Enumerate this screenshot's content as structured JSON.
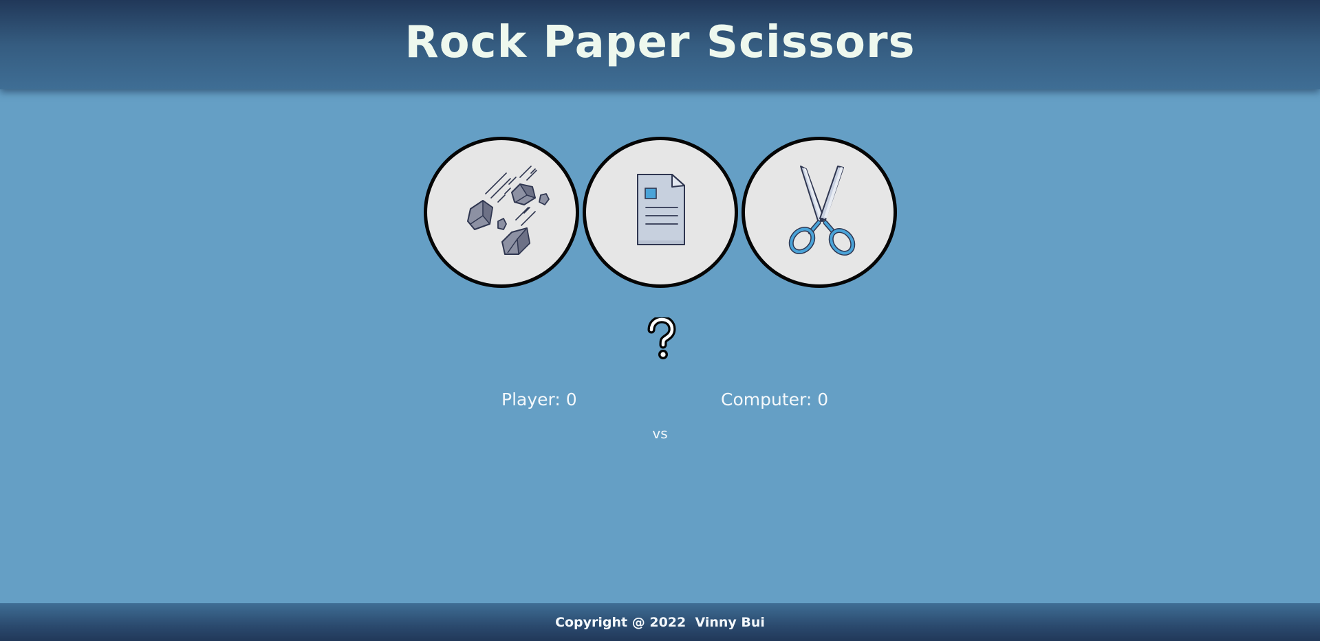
{
  "header": {
    "title": "Rock Paper Scissors"
  },
  "choices": [
    {
      "name": "rock",
      "icon": "rock-icon"
    },
    {
      "name": "paper",
      "icon": "paper-icon"
    },
    {
      "name": "scissors",
      "icon": "scissors-icon"
    }
  ],
  "result": {
    "icon": "question-mark-icon"
  },
  "scores": {
    "player": "Player: 0",
    "computer": "Computer: 0",
    "vs": "vs"
  },
  "footer": {
    "text": "Copyright @ 2022  Vinny Bui"
  },
  "colors": {
    "background": "#659fc5",
    "header_top": "#213859",
    "title": "#eef8ee",
    "choice_fill": "#e6e6e6",
    "choice_border": "#050505",
    "accent_blue": "#4aa3d8"
  }
}
